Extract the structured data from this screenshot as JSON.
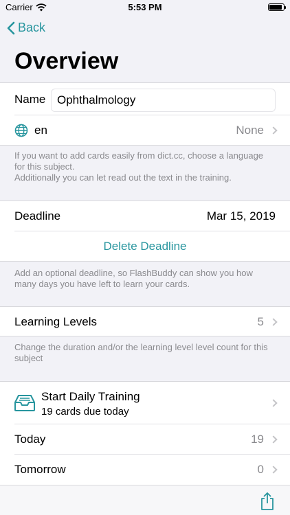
{
  "status_bar": {
    "carrier": "Carrier",
    "time": "5:53 PM",
    "battery_level": 0.9
  },
  "nav": {
    "back_label": "Back",
    "title": "Overview"
  },
  "subject": {
    "name_label": "Name",
    "name_value": "Ophthalmology",
    "language_code": "en",
    "language_value": "None",
    "language_footer_1": "If you want to add cards easily from dict.cc, choose a language for this subject.",
    "language_footer_2": "Additionally you can let read out the text in the training."
  },
  "deadline": {
    "label": "Deadline",
    "value": "Mar 15, 2019",
    "delete_label": "Delete Deadline",
    "footer": "Add an optional deadline, so FlashBuddy can show you how many days you have left to learn your cards."
  },
  "levels": {
    "label": "Learning Levels",
    "value": "5",
    "footer": "Change the duration and/or the learning level level count for this subject"
  },
  "training": {
    "title": "Start Daily Training",
    "subtitle": "19 cards due today",
    "today_label": "Today",
    "today_value": "19",
    "tomorrow_label": "Tomorrow",
    "tomorrow_value": "0"
  },
  "colors": {
    "accent": "#27959e",
    "background": "#f2f2f7"
  },
  "icons": {
    "globe": "globe-icon",
    "inbox": "inbox-tray-icon",
    "share": "share-icon",
    "back": "chevron-left-icon",
    "wifi": "wifi-icon"
  }
}
